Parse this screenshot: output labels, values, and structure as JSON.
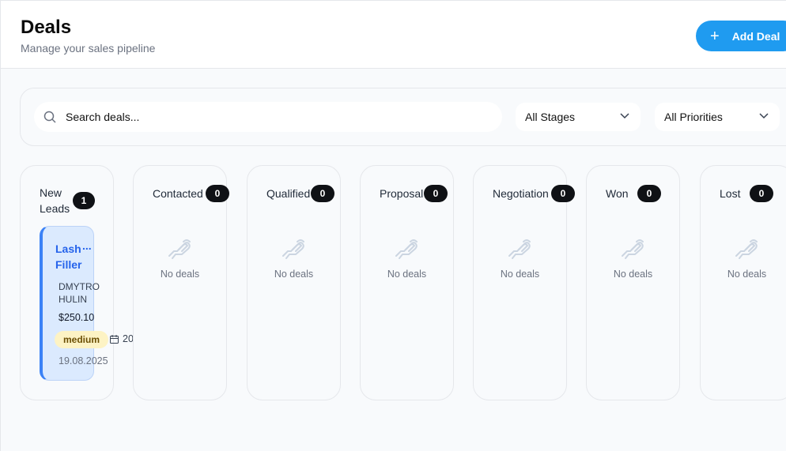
{
  "header": {
    "title": "Deals",
    "subtitle": "Manage your sales pipeline",
    "add_label": "Add Deal"
  },
  "filters": {
    "search_placeholder": "Search deals...",
    "stage_selected": "All Stages",
    "priority_selected": "All Priorities"
  },
  "columns": [
    {
      "name_line1": "New",
      "name_line2": "Leads",
      "count": "1"
    },
    {
      "name": "Contacted",
      "count": "0",
      "empty": "No deals"
    },
    {
      "name": "Qualified",
      "count": "0",
      "empty": "No deals"
    },
    {
      "name": "Proposal",
      "count": "0",
      "empty": "No deals"
    },
    {
      "name": "Negotiation",
      "count": "0",
      "empty": "No deals"
    },
    {
      "name": "Won",
      "count": "0",
      "empty": "No deals"
    },
    {
      "name": "Lost",
      "count": "0",
      "empty": "No deals"
    }
  ],
  "deal": {
    "title": "Lash Filler",
    "more": "...",
    "contact": "DMYTRO HULIN",
    "amount": "$250.10",
    "priority": "medium",
    "date_partial": "20",
    "date": "19.08.2025"
  },
  "colors": {
    "accent": "#1f9bf0",
    "badge": "#0f1115",
    "card_bg": "#dbeafe",
    "card_border": "#3b82f6",
    "priority_bg": "#fdf3c4"
  }
}
